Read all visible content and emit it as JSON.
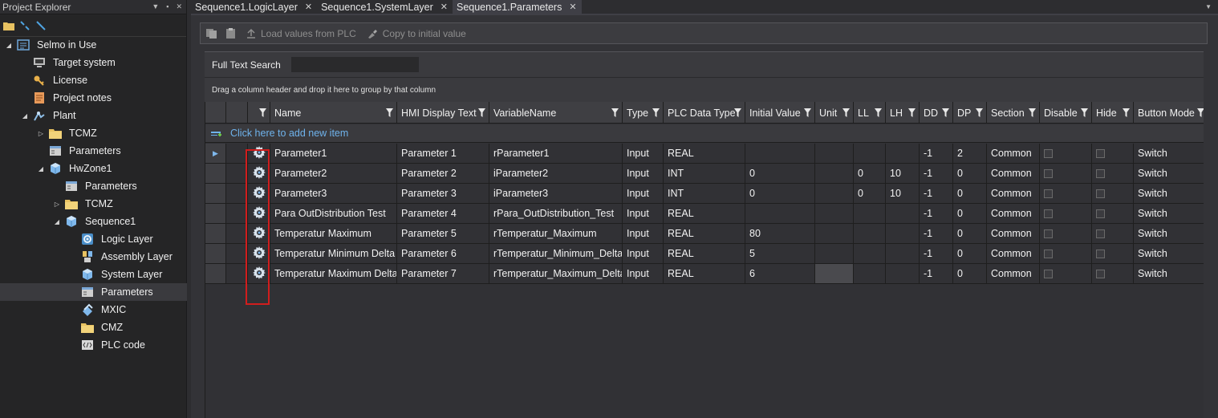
{
  "explorer": {
    "title": "Project Explorer",
    "tree": [
      {
        "label": "Selmo in Use",
        "icon": "project-icon",
        "expanded": true,
        "level": 0
      },
      {
        "label": "Target system",
        "icon": "monitor-icon",
        "level": 1
      },
      {
        "label": "License",
        "icon": "key-icon",
        "level": 1
      },
      {
        "label": "Project notes",
        "icon": "notes-icon",
        "level": 1
      },
      {
        "label": "Plant",
        "icon": "plant-icon",
        "expanded": true,
        "level": 1
      },
      {
        "label": "TCMZ",
        "icon": "folder-icon",
        "expanded": false,
        "level": 2
      },
      {
        "label": "Parameters",
        "icon": "parameters-icon",
        "level": 2
      },
      {
        "label": "HwZone1",
        "icon": "cube-icon",
        "expanded": true,
        "level": 2
      },
      {
        "label": "Parameters",
        "icon": "parameters-icon",
        "level": 3
      },
      {
        "label": "TCMZ",
        "icon": "folder-icon",
        "expanded": false,
        "level": 3
      },
      {
        "label": "Sequence1",
        "icon": "cube-icon",
        "expanded": true,
        "level": 3
      },
      {
        "label": "Logic Layer",
        "icon": "logic-layer-icon",
        "level": 4
      },
      {
        "label": "Assembly Layer",
        "icon": "assembly-layer-icon",
        "level": 4
      },
      {
        "label": "System Layer",
        "icon": "cube-icon",
        "level": 4
      },
      {
        "label": "Parameters",
        "icon": "parameters-icon",
        "level": 4,
        "selected": true
      },
      {
        "label": "MXIC",
        "icon": "mxic-icon",
        "level": 4
      },
      {
        "label": "CMZ",
        "icon": "folder-icon",
        "level": 4
      },
      {
        "label": "PLC code",
        "icon": "code-icon",
        "level": 4
      }
    ]
  },
  "tabs": [
    {
      "label": "Sequence1.LogicLayer",
      "active": false
    },
    {
      "label": "Sequence1.SystemLayer",
      "active": false
    },
    {
      "label": "Sequence1.Parameters",
      "active": true
    }
  ],
  "toolbar": {
    "load_label": "Load values from PLC",
    "copy_label": "Copy to initial value"
  },
  "search": {
    "label": "Full Text Search",
    "value": ""
  },
  "group_panel_text": "Drag a column header and drop it here to group by that column",
  "grid": {
    "columns": [
      "",
      "",
      "Name",
      "HMI Display Text",
      "VariableName",
      "Type",
      "PLC Data Type",
      "Initial Value",
      "Unit",
      "LL",
      "LH",
      "DD",
      "DP",
      "Section",
      "Disable",
      "Hide",
      "Button Mode"
    ],
    "new_row_label": "Click here to add new item",
    "rows": [
      {
        "name": "Parameter1",
        "hmi": "Parameter 1",
        "var": "rParameter1",
        "type": "Input",
        "plc": "REAL",
        "init": "",
        "unit": "",
        "ll": "",
        "lh": "",
        "dd": "-1",
        "dp": "2",
        "section": "Common",
        "disable": false,
        "hide": false,
        "mode": "Switch",
        "current": true
      },
      {
        "name": "Parameter2",
        "hmi": "Parameter 2",
        "var": "iParameter2",
        "type": "Input",
        "plc": "INT",
        "init": "0",
        "unit": "",
        "ll": "0",
        "lh": "10",
        "dd": "-1",
        "dp": "0",
        "section": "Common",
        "disable": false,
        "hide": false,
        "mode": "Switch"
      },
      {
        "name": "Parameter3",
        "hmi": "Parameter 3",
        "var": "iParameter3",
        "type": "Input",
        "plc": "INT",
        "init": "0",
        "unit": "",
        "ll": "0",
        "lh": "10",
        "dd": "-1",
        "dp": "0",
        "section": "Common",
        "disable": false,
        "hide": false,
        "mode": "Switch"
      },
      {
        "name": "Para OutDistribution Test",
        "hmi": "Parameter 4",
        "var": "rPara_OutDistribution_Test",
        "type": "Input",
        "plc": "REAL",
        "init": "",
        "unit": "",
        "ll": "",
        "lh": "",
        "dd": "-1",
        "dp": "0",
        "section": "Common",
        "disable": false,
        "hide": false,
        "mode": "Switch"
      },
      {
        "name": "Temperatur Maximum",
        "hmi": "Parameter 5",
        "var": "rTemperatur_Maximum",
        "type": "Input",
        "plc": "REAL",
        "init": "80",
        "unit": "",
        "ll": "",
        "lh": "",
        "dd": "-1",
        "dp": "0",
        "section": "Common",
        "disable": false,
        "hide": false,
        "mode": "Switch"
      },
      {
        "name": "Temperatur Minimum Delta",
        "hmi": "Parameter 6",
        "var": "rTemperatur_Minimum_Delta",
        "type": "Input",
        "plc": "REAL",
        "init": "5",
        "unit": "",
        "ll": "",
        "lh": "",
        "dd": "-1",
        "dp": "0",
        "section": "Common",
        "disable": false,
        "hide": false,
        "mode": "Switch"
      },
      {
        "name": "Temperatur Maximum Delta",
        "hmi": "Parameter 7",
        "var": "rTemperatur_Maximum_Delta",
        "type": "Input",
        "plc": "REAL",
        "init": "6",
        "unit": "",
        "ll": "",
        "lh": "",
        "dd": "-1",
        "dp": "0",
        "section": "Common",
        "disable": false,
        "hide": false,
        "mode": "Switch",
        "unit_highlight": true
      }
    ]
  },
  "colors": {
    "highlight_outline": "#d11d1d",
    "link": "#6fb3ec"
  }
}
